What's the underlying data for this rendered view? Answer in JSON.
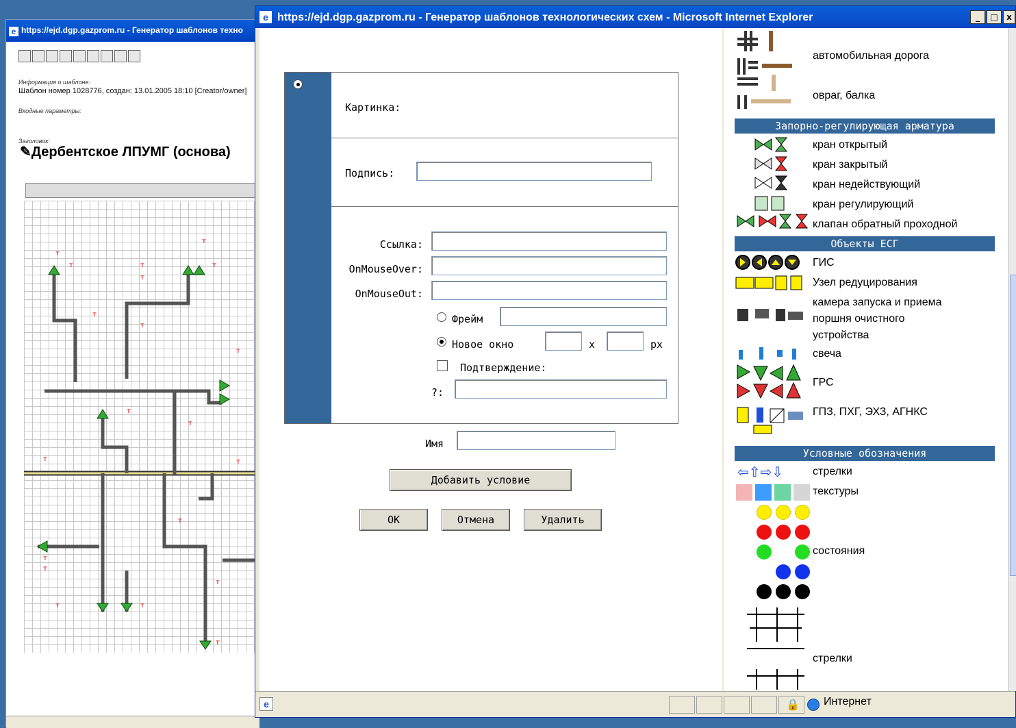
{
  "background_window": {
    "title": "https://ejd.dgp.gazprom.ru - Генератор шаблонов техно",
    "info_label": "Информация о шаблоне:",
    "info_text": "Шаблон номер 1028776, создан: 13.01.2005 18:10 [Creator/owner]",
    "params_label": "Входные параметры:",
    "header_label": "Заголовок:",
    "heading": "Дербентское ЛПУМГ (основа)",
    "status_zone": "Интернет"
  },
  "window": {
    "title": "https://ejd.dgp.gazprom.ru - Генератор шаблонов технологических схем - Microsoft Internet Explorer",
    "minimize": "_",
    "maximize": "□",
    "close": "x"
  },
  "form": {
    "picture_label": "Картинка:",
    "caption_label": "Подпись:",
    "caption_value": "",
    "link_label": "Ссылка:",
    "link_value": "",
    "onmouseover_label": "OnMouseOver:",
    "onmouseover_value": "",
    "onmouseout_label": "OnMouseOut:",
    "onmouseout_value": "",
    "frame_label": "Фрейм",
    "frame_value": "",
    "new_window_label": "Новое окно",
    "size_x": "x",
    "size_unit": "px",
    "confirm_label": "Подтверждение:",
    "question_label": "?:",
    "question_value": "",
    "name_label": "Имя",
    "name_value": "",
    "add_condition_button": "Добавить условие",
    "ok_button": "OK",
    "cancel_button": "Отмена",
    "delete_button": "Удалить"
  },
  "palette": {
    "items_top": [
      "автомобильная дорога",
      "овраг, балка"
    ],
    "section1": "Запорно-регулирующая арматура",
    "valves": [
      "кран открытый",
      "кран закрытый",
      "кран недействующий",
      "кран регулирующий",
      "клапан обратный проходной"
    ],
    "section2": "Объекты ЕСГ",
    "esg": [
      "ГИС",
      "Узел редуцирования",
      "камера запуска и приема",
      "поршня очистного",
      "устройства",
      "свеча",
      "ГРС",
      "ГПЗ, ПХГ, ЭХЗ, АГНКС"
    ],
    "section3": "Условные обозначения",
    "legend": [
      "стрелки",
      "текстуры",
      "состояния",
      "стрелки"
    ],
    "colors": {
      "yellow": "#ffee00",
      "red": "#ee1111",
      "green": "#22dd22",
      "blue": "#1133ee",
      "black": "#000000",
      "header": "#336699"
    }
  },
  "statusbar": {
    "zone": "Интернет"
  }
}
